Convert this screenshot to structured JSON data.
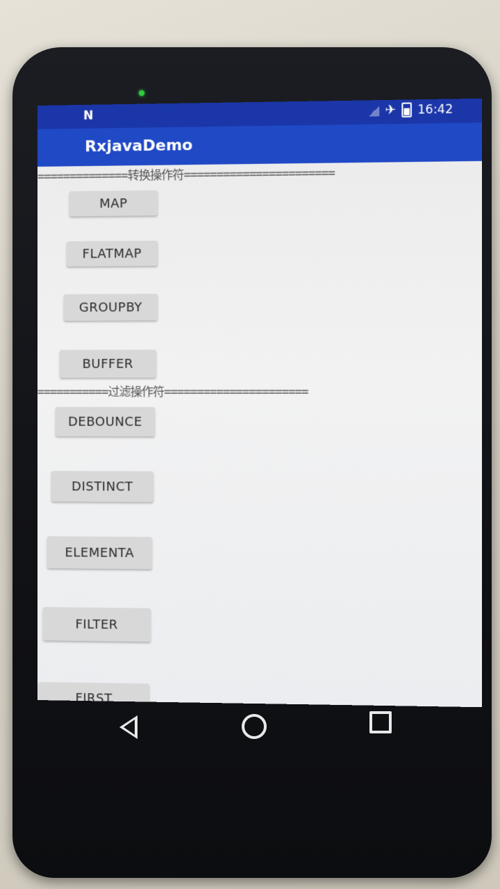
{
  "status_bar": {
    "left_icon": "N",
    "airplane_icon": "✈",
    "time": "16:42"
  },
  "app_bar": {
    "title": "RxjavaDemo"
  },
  "sections": {
    "transform_header": "==============转换操作符=======================",
    "filter_header": "==============过滤操作符======================"
  },
  "buttons": {
    "map": "MAP",
    "flatmap": "FLATMAP",
    "groupby": "GROUPBY",
    "buffer": "BUFFER",
    "debounce": "DEBOUNCE",
    "distinct": "DISTINCT",
    "elementa": "ELEMENTA",
    "filter": "FILTER",
    "first": "FIRST"
  },
  "colors": {
    "status_bar": "#1b36a8",
    "app_bar": "#2049c6",
    "button": "#d8d8d8"
  }
}
